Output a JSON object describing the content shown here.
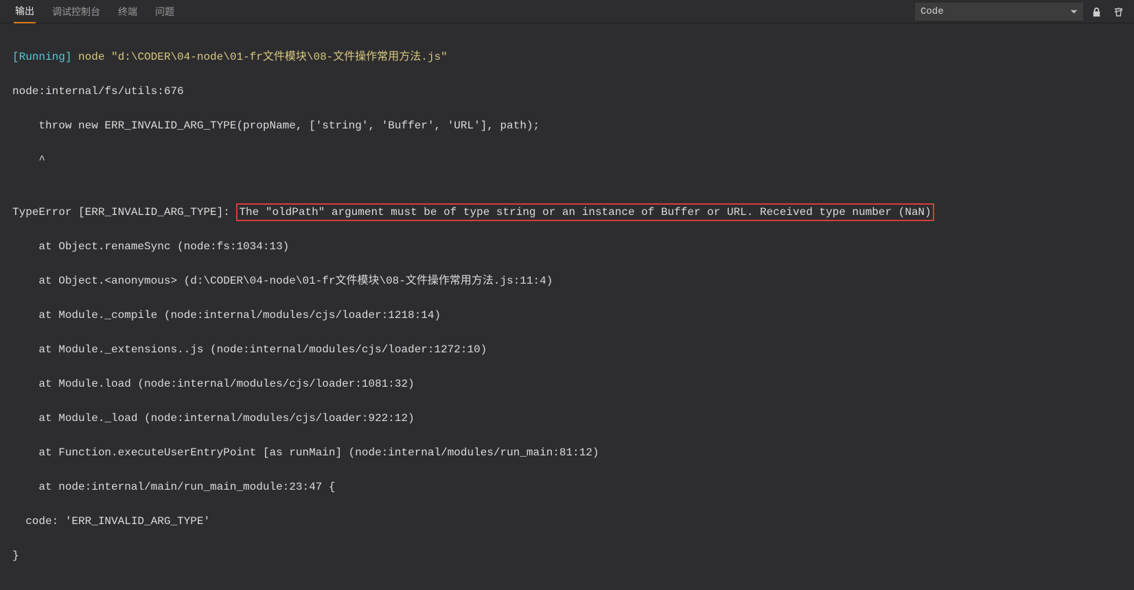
{
  "tabs": {
    "output": "输出",
    "debug_console": "调试控制台",
    "terminal": "终端",
    "problems": "问题"
  },
  "dropdown": {
    "selected": "Code"
  },
  "output": {
    "running_tag": "[Running]",
    "running_cmd": " node \"d:\\CODER\\04-node\\01-fr文件模块\\08-文件操作常用方法.js\"",
    "l2": "node:internal/fs/utils:676",
    "l3": "    throw new ERR_INVALID_ARG_TYPE(propName, ['string', 'Buffer', 'URL'], path);",
    "l4": "    ^",
    "l5": "",
    "err_prefix": "TypeError [ERR_INVALID_ARG_TYPE]: ",
    "err_msg": "The \"oldPath\" argument must be of type string or an instance of Buffer or URL. Received type number (NaN)",
    "l7": "    at Object.renameSync (node:fs:1034:13)",
    "l8": "    at Object.<anonymous> (d:\\CODER\\04-node\\01-fr文件模块\\08-文件操作常用方法.js:11:4)",
    "l9": "    at Module._compile (node:internal/modules/cjs/loader:1218:14)",
    "l10": "    at Module._extensions..js (node:internal/modules/cjs/loader:1272:10)",
    "l11": "    at Module.load (node:internal/modules/cjs/loader:1081:32)",
    "l12": "    at Module._load (node:internal/modules/cjs/loader:922:12)",
    "l13": "    at Function.executeUserEntryPoint [as runMain] (node:internal/modules/run_main:81:12)",
    "l14": "    at node:internal/main/run_main_module:23:47 {",
    "l15": "  code: 'ERR_INVALID_ARG_TYPE'",
    "l16": "}"
  }
}
